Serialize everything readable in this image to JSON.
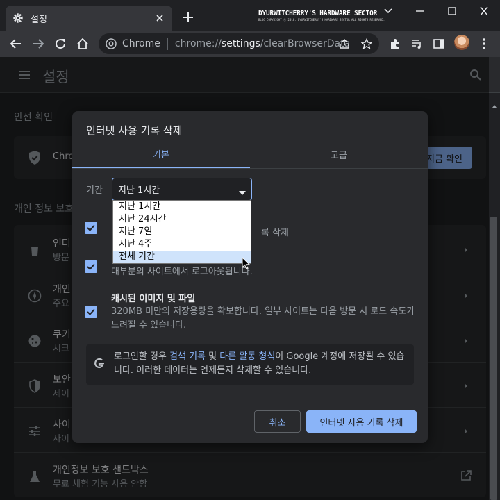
{
  "tab": {
    "title": "설정"
  },
  "watermark": {
    "main": "DYURWITCHERRY'S HARDWARE SECTOR",
    "sub": "BLOG COPYRIGHT ⓒ 2018. DYURWITCHERRY'S HARDWARE SECTOR ALL RIGHTS RESERVED."
  },
  "omnibox": {
    "site_label": "Chrome",
    "url_scheme": "chrome://",
    "url_host": "settings",
    "url_path": "/clearBrowserData"
  },
  "settings": {
    "title": "설정",
    "safety_section": "안전 확인",
    "safety_text": "Chro",
    "check_now": "지금 확인",
    "privacy_section": "개인 정보 보호",
    "rows": [
      {
        "title": "인터",
        "sub": "방문"
      },
      {
        "title": "개인",
        "sub": "주요"
      },
      {
        "title": "쿠키",
        "sub": "시크"
      },
      {
        "title": "보안",
        "sub": "세이"
      },
      {
        "title": "사이",
        "sub": "사이"
      },
      {
        "title": "개인정보 보호 샌드박스",
        "sub": "무료 체험 기능 사용 안함"
      }
    ]
  },
  "dialog": {
    "title": "인터넷 사용 기록 삭제",
    "tab_basic": "기본",
    "tab_advanced": "고급",
    "range_label": "기간",
    "range_value": "지난 1시간",
    "options": [
      {
        "title": "",
        "desc": "록 삭제",
        "checked": true
      },
      {
        "title": "",
        "desc": "대부분의 사이트에서 로그아웃됩니다.",
        "checked": true
      },
      {
        "title": "캐시된 이미지 및 파일",
        "desc": "320MB 미만의 저장용량을 확보합니다. 일부 사이트는 다음 방문 시 로드 속도가 느려질 수 있습니다.",
        "checked": true
      }
    ],
    "info": {
      "pre": "로그인할 경우 ",
      "link1": "검색 기록",
      "mid": " 및 ",
      "link2": "다른 활동 형식",
      "post": "이 Google 계정에 저장될 수 있습니다. 이러한 데이터는 언제든지 삭제할 수 있습니다."
    },
    "cancel": "취소",
    "clear": "인터넷 사용 기록 삭제"
  },
  "dropdown": {
    "options": [
      "지난 1시간",
      "지난 24시간",
      "지난 7일",
      "지난 4주",
      "전체 기간"
    ],
    "highlighted_index": 4
  }
}
